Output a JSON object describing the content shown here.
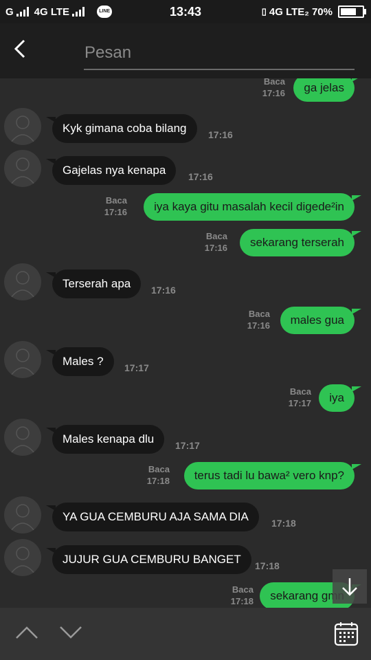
{
  "status_bar": {
    "left_carrier": "G",
    "left_network": "4G LTE",
    "line_icon_label": "LINE",
    "time": "13:43",
    "right_network": "4G LTE₂",
    "battery": "70%"
  },
  "header": {
    "search_placeholder": "Pesan",
    "back_icon": "chevron-left-icon"
  },
  "messages": [
    {
      "side": "out",
      "text": "ga jelas",
      "read": "Baca",
      "time": "17:16"
    },
    {
      "side": "in",
      "text": "Kyk gimana coba bilang",
      "time": "17:16"
    },
    {
      "side": "in",
      "text": "Gajelas nya kenapa",
      "time": "17:16"
    },
    {
      "side": "out",
      "text": "iya kaya gitu masalah kecil digede²in",
      "read": "Baca",
      "time": "17:16"
    },
    {
      "side": "out",
      "text": "sekarang terserah",
      "read": "Baca",
      "time": "17:16"
    },
    {
      "side": "in",
      "text": "Terserah apa",
      "time": "17:16"
    },
    {
      "side": "out",
      "text": "males gua",
      "read": "Baca",
      "time": "17:16"
    },
    {
      "side": "in",
      "text": "Males ?",
      "time": "17:17"
    },
    {
      "side": "out",
      "text": "iya",
      "read": "Baca",
      "time": "17:17"
    },
    {
      "side": "in",
      "text": "Males kenapa dlu",
      "time": "17:17"
    },
    {
      "side": "out",
      "text": "terus tadi lu bawa² vero knp?",
      "read": "Baca",
      "time": "17:18"
    },
    {
      "side": "in",
      "text": "YA GUA CEMBURU AJA SAMA DIA",
      "time": "17:18"
    },
    {
      "side": "in",
      "text": "JUJUR GUA CEMBURU BANGET",
      "time": "17:18"
    },
    {
      "side": "out",
      "text": "sekarang gmn",
      "read": "Baca",
      "time": "17:18"
    }
  ],
  "icons": {
    "scroll_down": "arrow-down-icon",
    "prev": "chevron-up-icon",
    "next": "chevron-down-icon",
    "calendar": "calendar-icon"
  },
  "colors": {
    "outgoing_bubble": "#2fc353",
    "incoming_bubble": "#171717",
    "background": "#2b2b2b"
  }
}
